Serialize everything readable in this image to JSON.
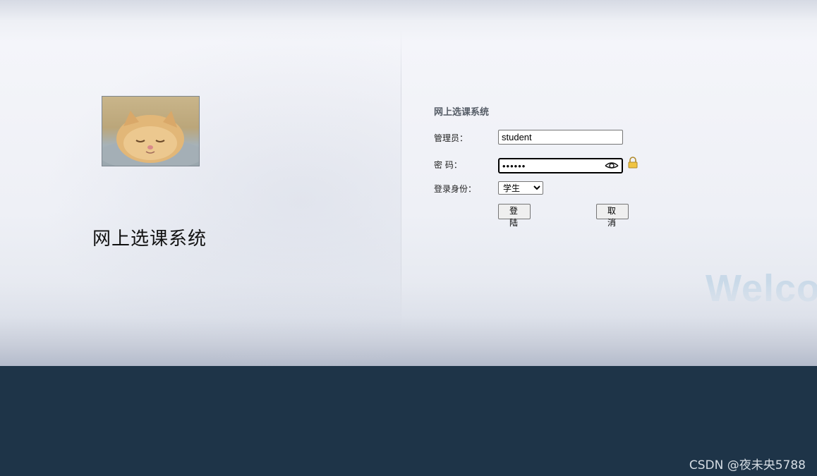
{
  "login_page": {
    "system_title": "网上选课系统",
    "form_title": "网上选课系统",
    "username": {
      "label": "管理员：",
      "value": "student"
    },
    "password": {
      "label": "密 码：",
      "value": "••••••"
    },
    "role": {
      "label": "登录身份：",
      "selected": "学生"
    },
    "login_button": "登 陆",
    "cancel_button": "取 消",
    "welcome_text": "Welcome"
  },
  "watermark": "CSDN @夜未央5788",
  "colors": {
    "bottom_band": "#1e3448",
    "welcome_text": "#c9d9e8"
  },
  "icons": [
    "kitten-photo",
    "eye-icon",
    "lock-icon"
  ]
}
